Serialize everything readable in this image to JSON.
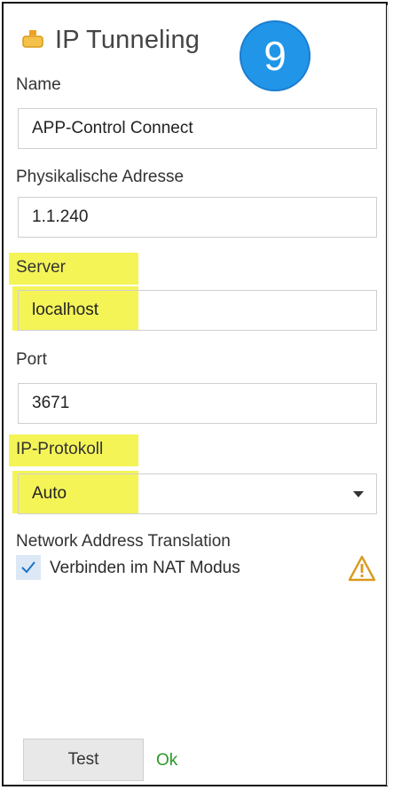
{
  "header": {
    "title": "IP Tunneling",
    "step_badge": "9",
    "icon": "plug-icon"
  },
  "form": {
    "name": {
      "label": "Name",
      "value": "APP-Control Connect"
    },
    "physical_address": {
      "label": "Physikalische Adresse",
      "value": "1.1.240"
    },
    "server": {
      "label": "Server",
      "value": "localhost"
    },
    "port": {
      "label": "Port",
      "value": "3671"
    },
    "ip_protocol": {
      "label": "IP-Protokoll",
      "value": "Auto"
    },
    "nat": {
      "section_label": "Network Address Translation",
      "checkbox_label": "Verbinden im NAT Modus",
      "checked": true
    }
  },
  "footer": {
    "test_button": "Test",
    "status": "Ok"
  },
  "colors": {
    "badge": "#2196e8",
    "highlight": "#f2f23a",
    "ok": "#2a9a2a",
    "warning": "#d99a1e"
  }
}
